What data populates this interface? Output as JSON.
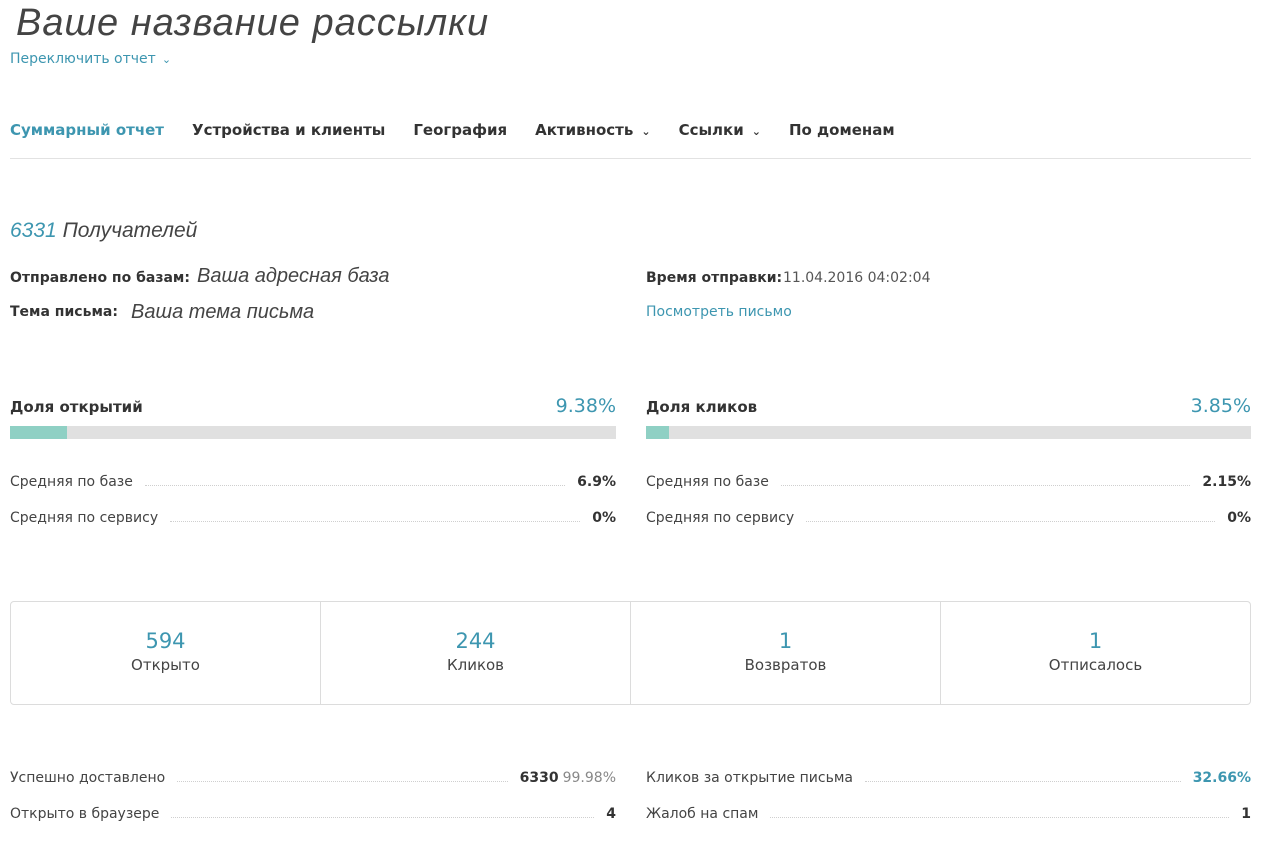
{
  "header": {
    "title": "Ваше название рассылки",
    "switch_report": "Переключить отчет"
  },
  "tabs": [
    {
      "label": "Суммарный отчет",
      "active": true
    },
    {
      "label": "Устройства и клиенты"
    },
    {
      "label": "География"
    },
    {
      "label": "Активность",
      "dropdown": true
    },
    {
      "label": "Ссылки",
      "dropdown": true
    },
    {
      "label": "По доменам"
    }
  ],
  "recipients": {
    "count": "6331",
    "label": "Получателей"
  },
  "meta": {
    "sent_bases_label": "Отправлено по базам:",
    "sent_bases_value": "Ваша адресная база",
    "subject_label": "Тема письма:",
    "subject_value": "Ваша тема письма",
    "send_time_label": "Время отправки:",
    "send_time_value": "11.04.2016 04:02:04",
    "view_letter": "Посмотреть письмо"
  },
  "open_rate": {
    "label": "Доля открытий",
    "value": "9.38%",
    "fraction": 0.0938,
    "avg_base_label": "Средняя по базе",
    "avg_base": "6.9%",
    "avg_service_label": "Средняя по сервису",
    "avg_service": "0%"
  },
  "click_rate": {
    "label": "Доля кликов",
    "value": "3.85%",
    "fraction": 0.0385,
    "avg_base_label": "Средняя по базе",
    "avg_base": "2.15%",
    "avg_service_label": "Средняя по сервису",
    "avg_service": "0%"
  },
  "stats": [
    {
      "value": "594",
      "label": "Открыто"
    },
    {
      "value": "244",
      "label": "Кликов"
    },
    {
      "value": "1",
      "label": "Возвратов"
    },
    {
      "value": "1",
      "label": "Отписалось"
    }
  ],
  "bottom": {
    "delivered_label": "Успешно доставлено",
    "delivered_value": "6330",
    "delivered_pct": "99.98%",
    "browser_label": "Открыто в браузере",
    "browser_value": "4",
    "ctor_label": "Кликов за открытие письма",
    "ctor_value": "32.66%",
    "spam_label": "Жалоб на спам",
    "spam_value": "1"
  },
  "colors": {
    "accent": "#3d96b0",
    "bar_fill": "#8fd0c4",
    "bar_track": "#e0e0e0"
  }
}
